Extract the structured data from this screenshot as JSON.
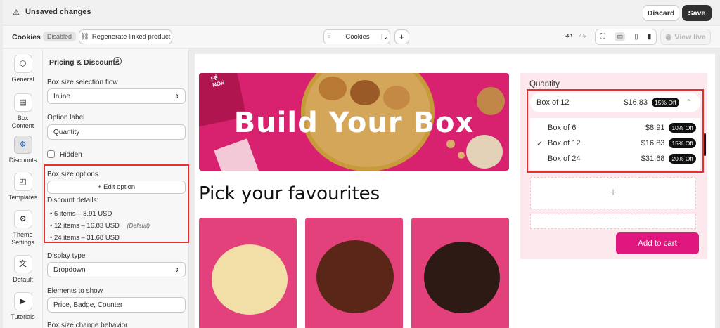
{
  "topbar": {
    "title": "Unsaved changes",
    "discard": "Discard",
    "save": "Save"
  },
  "subbar": {
    "product": "Cookies",
    "status": "Disabled",
    "regenerate": "Regenerate linked product",
    "selector": "Cookies",
    "view_live": "View live"
  },
  "rail": [
    {
      "label": "General",
      "icon": "cube-icon"
    },
    {
      "label": "Box Content",
      "icon": "box-content-icon"
    },
    {
      "label": "Discounts",
      "icon": "discount-icon"
    },
    {
      "label": "Templates",
      "icon": "template-icon"
    },
    {
      "label": "Theme Settings",
      "icon": "gear-icon"
    },
    {
      "label": "Default",
      "icon": "translate-icon"
    },
    {
      "label": "Tutorials",
      "icon": "youtube-icon"
    }
  ],
  "panel": {
    "heading": "Pricing & Discounts",
    "flow_label": "Box size selection flow",
    "flow_value": "Inline",
    "option_label": "Option label",
    "option_value": "Quantity",
    "hidden": "Hidden",
    "box_options": "Box size options",
    "edit_option": "+ Edit option",
    "discount_details": "Discount details:",
    "discounts": [
      {
        "text": "6 items – 8.91 USD",
        "note": ""
      },
      {
        "text": "12 items – 16.83 USD",
        "note": "(Default)"
      },
      {
        "text": "24 items – 31.68 USD",
        "note": ""
      }
    ],
    "display_type_label": "Display type",
    "display_type_value": "Dropdown",
    "elements_label": "Elements to show",
    "elements_value": "Price, Badge, Counter",
    "change_behavior_label": "Box size change behavior"
  },
  "preview": {
    "banner_title": "Build Your Box",
    "heading": "Pick your favourites",
    "banner_brand": "FÉ\nNOR",
    "quantity_label": "Quantity",
    "selected": {
      "label": "Box of 12",
      "price": "$16.83",
      "badge": "15% Off"
    },
    "options": [
      {
        "label": "Box of 6",
        "price": "$8.91",
        "badge": "10% Off",
        "checked": false
      },
      {
        "label": "Box of 12",
        "price": "$16.83",
        "badge": "15% Off",
        "checked": true
      },
      {
        "label": "Box of 24",
        "price": "$31.68",
        "badge": "20% Off",
        "checked": false
      }
    ],
    "plus": "+",
    "add_to_cart": "Add to cart"
  },
  "colors": {
    "accent": "#e0177e",
    "highlight": "#e53030",
    "pink_bg": "#fde8ee"
  }
}
